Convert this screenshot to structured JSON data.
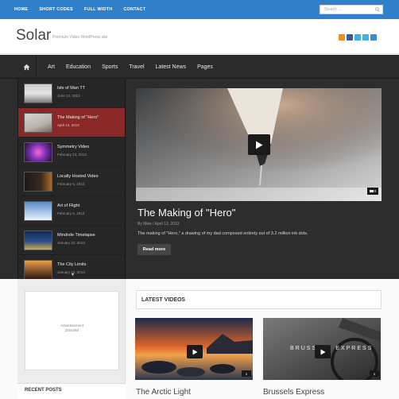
{
  "topnav": {
    "items": [
      "HOME",
      "SHORT CODES",
      "FULL WIDTH",
      "CONTACT"
    ]
  },
  "search": {
    "placeholder": "Search ..."
  },
  "header": {
    "logo": "Solar",
    "tagline": "Premium Video WordPress site"
  },
  "social": {
    "icons": [
      "rss-icon",
      "facebook-icon",
      "twitter-icon",
      "vimeo-icon",
      "email-icon"
    ],
    "colors": [
      "#f28c1e",
      "#3b5998",
      "#35b3e5",
      "#44b4dd",
      "#3b8fd1"
    ]
  },
  "mainnav": {
    "items": [
      "Art",
      "Education",
      "Sports",
      "Travel",
      "Latest News",
      "Pages"
    ]
  },
  "videos": [
    {
      "title": "Isle of Man TT",
      "date": "June 13, 2013"
    },
    {
      "title": "The Making of \"Hero\"",
      "date": "April 13, 2013"
    },
    {
      "title": "Symmetry Video",
      "date": "February 13, 2013"
    },
    {
      "title": "Locally Hosted Video",
      "date": "February 6, 2013"
    },
    {
      "title": "Art of Flight",
      "date": "February 5, 2013"
    },
    {
      "title": "Mindrele Timelapse",
      "date": "January 22, 2013"
    },
    {
      "title": "The City Limits",
      "date": "January 15, 2013"
    }
  ],
  "featured": {
    "title": "The Making of \"Hero\"",
    "meta": "By Mike / April 13, 2013",
    "description": "The making of \"Hero,\" a drawing of my dad composed entirely out of 3.2 million ink dots.",
    "button": "Read more",
    "comments": "0"
  },
  "ad": {
    "line1": "Advertisement",
    "line2": "300x250"
  },
  "recent_posts": "RECENT POSTS",
  "latest": {
    "heading": "LATEST VIDEOS",
    "cards": [
      {
        "title": "The Arctic Light",
        "comments": "0"
      },
      {
        "title": "Brussels Express",
        "comments": "0",
        "overlay": "BRUSSELS EXPRESS"
      }
    ]
  },
  "colors": {
    "topbar": "#2f7fc9",
    "active": "#8a2828",
    "dark": "#2d2d2d"
  }
}
